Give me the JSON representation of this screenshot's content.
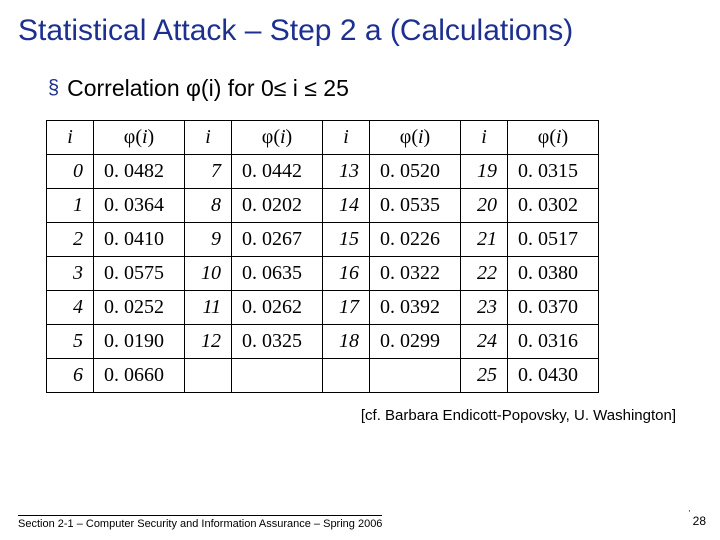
{
  "title": "Statistical Attack – Step 2 a (Calculations)",
  "subtitle_prefix": "Correlation ",
  "subtitle_phi": "φ(i)",
  "subtitle_suffix": " for 0≤ i ≤ 25",
  "header": {
    "i": "i",
    "phi_raw": "φ(i)"
  },
  "rows": [
    {
      "c0i": "0",
      "c0v": "0. 0482",
      "c1i": "7",
      "c1v": "0. 0442",
      "c2i": "13",
      "c2v": "0. 0520",
      "c3i": "19",
      "c3v": "0. 0315"
    },
    {
      "c0i": "1",
      "c0v": "0. 0364",
      "c1i": "8",
      "c1v": "0. 0202",
      "c2i": "14",
      "c2v": "0. 0535",
      "c3i": "20",
      "c3v": "0. 0302"
    },
    {
      "c0i": "2",
      "c0v": "0. 0410",
      "c1i": "9",
      "c1v": "0. 0267",
      "c2i": "15",
      "c2v": "0. 0226",
      "c3i": "21",
      "c3v": "0. 0517"
    },
    {
      "c0i": "3",
      "c0v": "0. 0575",
      "c1i": "10",
      "c1v": "0. 0635",
      "c2i": "16",
      "c2v": "0. 0322",
      "c3i": "22",
      "c3v": "0. 0380"
    },
    {
      "c0i": "4",
      "c0v": "0. 0252",
      "c1i": "11",
      "c1v": "0. 0262",
      "c2i": "17",
      "c2v": "0. 0392",
      "c3i": "23",
      "c3v": "0. 0370"
    },
    {
      "c0i": "5",
      "c0v": "0. 0190",
      "c1i": "12",
      "c1v": "0. 0325",
      "c2i": "18",
      "c2v": "0. 0299",
      "c3i": "24",
      "c3v": "0. 0316"
    },
    {
      "c0i": "6",
      "c0v": "0. 0660",
      "c1i": "",
      "c1v": "",
      "c2i": "",
      "c2v": "",
      "c3i": "25",
      "c3v": "0. 0430"
    }
  ],
  "credit": "[cf. Barbara Endicott-Popovsky, U. Washington]",
  "footer": "Section 2-1 – Computer Security and Information Assurance – Spring 2006",
  "pagenum": "28",
  "chart_data": {
    "type": "table",
    "title": "Correlation φ(i) for 0 ≤ i ≤ 25",
    "columns": [
      "i",
      "φ(i)"
    ],
    "data": [
      {
        "i": 0,
        "phi": 0.0482
      },
      {
        "i": 1,
        "phi": 0.0364
      },
      {
        "i": 2,
        "phi": 0.041
      },
      {
        "i": 3,
        "phi": 0.0575
      },
      {
        "i": 4,
        "phi": 0.0252
      },
      {
        "i": 5,
        "phi": 0.019
      },
      {
        "i": 6,
        "phi": 0.066
      },
      {
        "i": 7,
        "phi": 0.0442
      },
      {
        "i": 8,
        "phi": 0.0202
      },
      {
        "i": 9,
        "phi": 0.0267
      },
      {
        "i": 10,
        "phi": 0.0635
      },
      {
        "i": 11,
        "phi": 0.0262
      },
      {
        "i": 12,
        "phi": 0.0325
      },
      {
        "i": 13,
        "phi": 0.052
      },
      {
        "i": 14,
        "phi": 0.0535
      },
      {
        "i": 15,
        "phi": 0.0226
      },
      {
        "i": 16,
        "phi": 0.0322
      },
      {
        "i": 17,
        "phi": 0.0392
      },
      {
        "i": 18,
        "phi": 0.0299
      },
      {
        "i": 19,
        "phi": 0.0315
      },
      {
        "i": 20,
        "phi": 0.0302
      },
      {
        "i": 21,
        "phi": 0.0517
      },
      {
        "i": 22,
        "phi": 0.038
      },
      {
        "i": 23,
        "phi": 0.037
      },
      {
        "i": 24,
        "phi": 0.0316
      },
      {
        "i": 25,
        "phi": 0.043
      }
    ]
  }
}
